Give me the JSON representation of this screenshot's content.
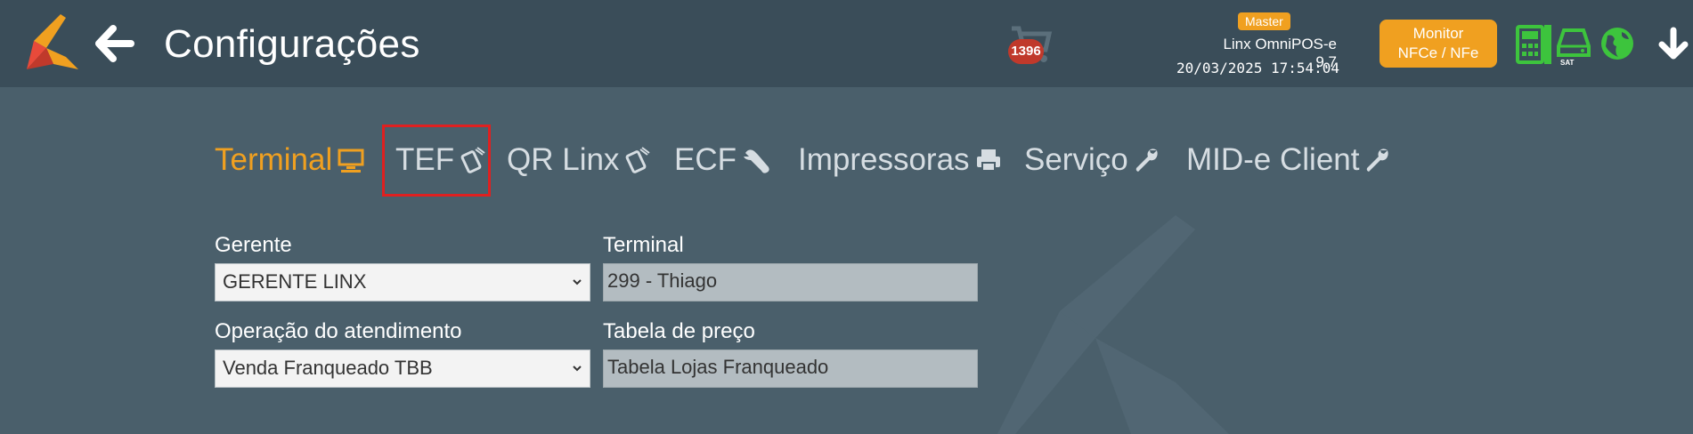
{
  "header": {
    "title": "Configurações",
    "cart_count": "1396",
    "role_badge": "Master",
    "app_version": "Linx OmniPOS-e  9.7",
    "datetime": "20/03/2025 17:54:04",
    "monitor_button": {
      "line1": "Monitor",
      "line2": "NFCe / NFe"
    },
    "icons": [
      "logo",
      "back-arrow-icon",
      "cart-icon",
      "calculator-icon",
      "sat-icon",
      "globe-icon",
      "arrow-down-icon"
    ]
  },
  "tabs": [
    {
      "label": "Terminal",
      "icon": "desktop-icon",
      "active": true
    },
    {
      "label": "TEF",
      "icon": "card-payment-icon",
      "active": false
    },
    {
      "label": "QR Linx",
      "icon": "card-payment-icon",
      "active": false
    },
    {
      "label": "ECF",
      "icon": "wrench-icon",
      "active": false
    },
    {
      "label": "Impressoras",
      "icon": "printer-icon",
      "active": false
    },
    {
      "label": "Serviço",
      "icon": "wrench-icon",
      "active": false
    },
    {
      "label": "MID-e Client",
      "icon": "wrench-icon",
      "active": false
    }
  ],
  "form": {
    "gerente": {
      "label": "Gerente",
      "value": "GERENTE LINX"
    },
    "terminal": {
      "label": "Terminal",
      "value": "299 - Thiago"
    },
    "operacao": {
      "label": "Operação do atendimento",
      "value": "Venda Franqueado TBB"
    },
    "tabela": {
      "label": "Tabela de preço",
      "value": "Tabela Lojas Franqueado"
    }
  },
  "colors": {
    "header_bg": "#3a4d59",
    "page_bg": "#4a5f6b",
    "accent": "#f0a020",
    "highlight": "#e02020",
    "status_green": "#3dc43d"
  }
}
